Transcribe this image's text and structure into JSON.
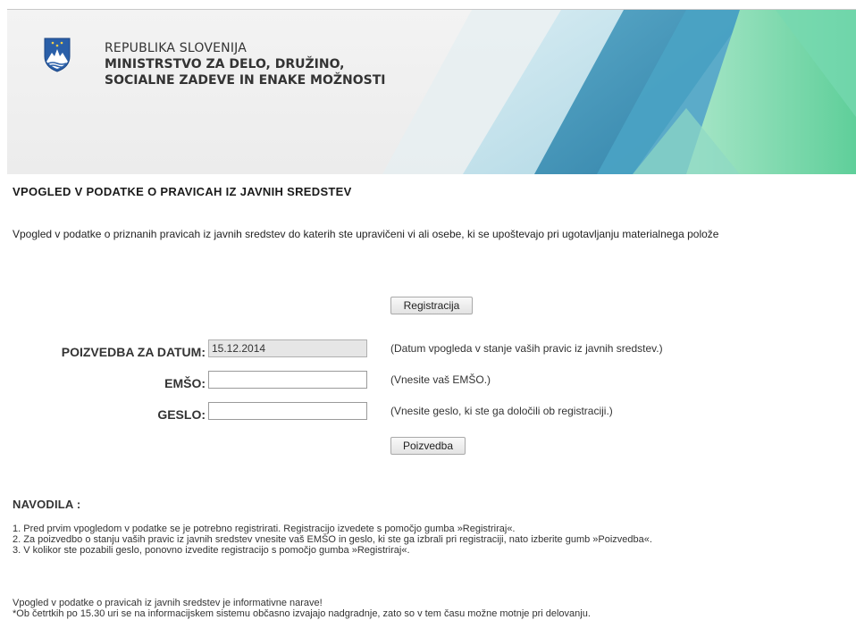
{
  "header": {
    "line1": "REPUBLIKA SLOVENIJA",
    "line2": "MINISTRSTVO ZA DELO, DRUŽINO,",
    "line3": "SOCIALNE ZADEVE IN ENAKE MOŽNOSTI",
    "crest_icon": "slovenia-crest-icon"
  },
  "page": {
    "title": "VPOGLED V PODATKE O PRAVICAH IZ JAVNIH SREDSTEV",
    "intro": "Vpogled v podatke o priznanih pravicah iz javnih sredstev do katerih ste upravičeni vi ali osebe, ki se upoštevajo pri ugotavljanju materialnega polože"
  },
  "form": {
    "register_button": "Registracija",
    "date_label": "POIZVEDBA ZA DATUM:",
    "date_value": "15.12.2014",
    "date_hint": "(Datum vpogleda v stanje vaših pravic iz javnih sredstev.)",
    "emso_label": "EMŠO:",
    "emso_value": "",
    "emso_hint": "(Vnesite vaš EMŠO.)",
    "password_label": "GESLO:",
    "password_value": "",
    "password_hint": "(Vnesite geslo, ki ste ga določili ob registraciji.)",
    "query_button": "Poizvedba"
  },
  "instructions": {
    "title": "NAVODILA :",
    "items": [
      "1.  Pred prvim vpogledom v podatke se je potrebno registrirati. Registracijo izvedete s pomočjo gumba »Registriraj«.",
      "2.  Za poizvedbo o stanju vaših pravic iz javnih sredstev vnesite vaš EMŠO in geslo, ki ste ga izbrali pri registraciji, nato izberite gumb »Poizvedba«.",
      "3.  V kolikor ste pozabili geslo, ponovno izvedite registracijo s pomočjo gumba »Registriraj«."
    ]
  },
  "footer": {
    "line1": "Vpogled v podatke o pravicah iz javnih sredstev je informativne narave!",
    "line2": "*Ob četrtkih po 15.30 uri se na informacijskem sistemu občasno izvajajo nadgradnje, zato so v tem času možne motnje pri delovanju."
  },
  "colors": {
    "banner_teal": "#3f9fbf",
    "banner_green": "#7fd8a6",
    "crest_blue": "#2a5fa8"
  }
}
